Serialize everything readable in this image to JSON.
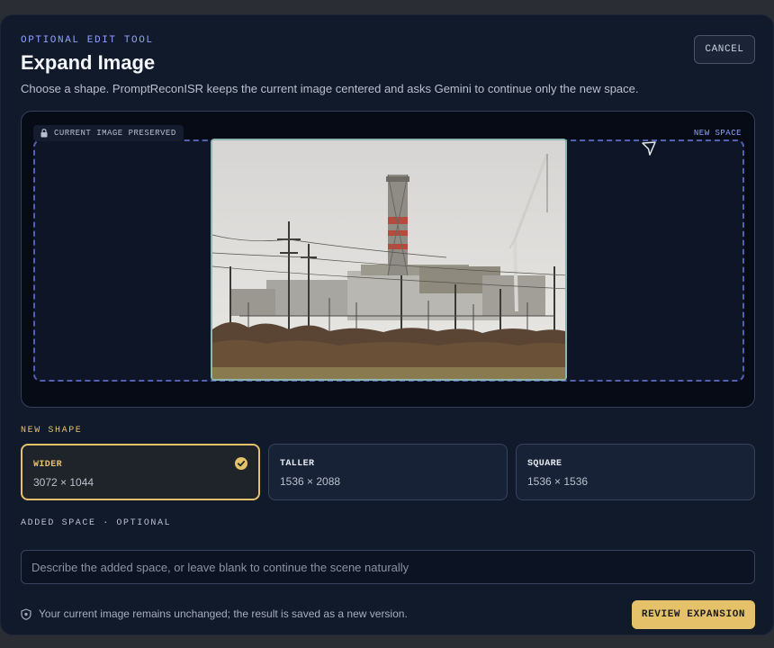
{
  "header": {
    "eyebrow": "OPTIONAL EDIT TOOL",
    "title": "Expand Image",
    "subtitle": "Choose a shape. PromptReconISR keeps the current image centered and asks Gemini to continue only the new space.",
    "cancel_label": "CANCEL"
  },
  "canvas": {
    "preserved_label": "CURRENT IMAGE PRESERVED",
    "new_space_label": "NEW SPACE",
    "image_alt": "Industrial power plant with cooling tower, crane and power lines under an overcast sky"
  },
  "shape_section": {
    "label": "NEW SHAPE",
    "options": [
      {
        "name": "WIDER",
        "dims": "3072 × 1044",
        "selected": true
      },
      {
        "name": "TALLER",
        "dims": "1536 × 2088",
        "selected": false
      },
      {
        "name": "SQUARE",
        "dims": "1536 × 1536",
        "selected": false
      }
    ]
  },
  "added_space": {
    "label": "ADDED SPACE · OPTIONAL",
    "placeholder": "Describe the added space, or leave blank to continue the scene naturally",
    "value": ""
  },
  "footer": {
    "note": "Your current image remains unchanged; the result is saved as a new version.",
    "review_label": "REVIEW EXPANSION"
  },
  "colors": {
    "accent_gold": "#e5c16a",
    "accent_blue": "#8fa2ff",
    "panel_bg": "#111a2b"
  },
  "icons": {
    "lock": "lock-icon",
    "cursor": "cursor-arrow-icon",
    "check": "check-circle-icon",
    "shield": "shield-icon"
  }
}
